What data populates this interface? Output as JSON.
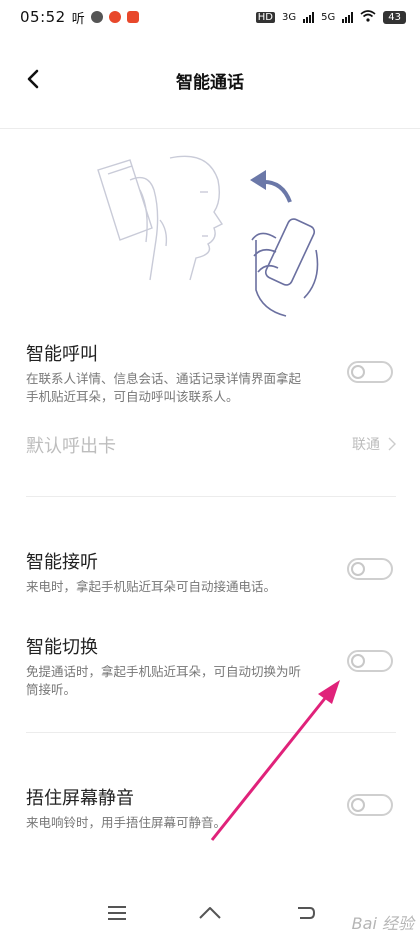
{
  "status": {
    "time": "05:52",
    "listen_label": "听",
    "network_hd": "HD",
    "net_3g": "3G",
    "net_5g": "5G",
    "battery": "43"
  },
  "header": {
    "title": "智能通话"
  },
  "settings": {
    "smart_call": {
      "title": "智能呼叫",
      "desc": "在联系人详情、信息会话、通话记录详情界面拿起手机贴近耳朵，可自动呼叫该联系人。",
      "enabled": false
    },
    "default_sim": {
      "label": "默认呼出卡",
      "value": "联通"
    },
    "smart_answer": {
      "title": "智能接听",
      "desc": "来电时，拿起手机贴近耳朵可自动接通电话。",
      "enabled": false
    },
    "smart_switch": {
      "title": "智能切换",
      "desc": "免提通话时，拿起手机贴近耳朵，可自动切换为听筒接听。",
      "enabled": false
    },
    "cover_mute": {
      "title": "捂住屏幕静音",
      "desc": "来电响铃时，用手捂住屏幕可静音。",
      "enabled": false
    }
  },
  "watermark": "Bai 经验",
  "colors": {
    "annotation_arrow": "#e0227a",
    "toggle_off": "#cfcfcf"
  }
}
